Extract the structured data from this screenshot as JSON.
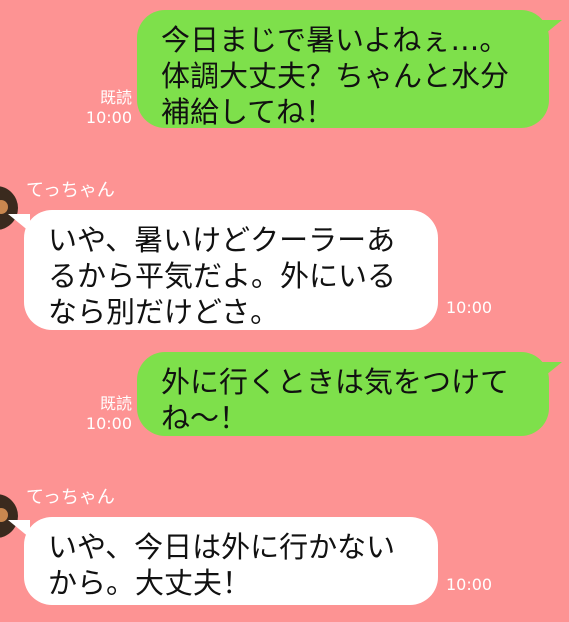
{
  "messages": [
    {
      "direction": "sent",
      "text": "今日まじで暑いよねぇ…。\n体調大丈夫？ちゃんと水分\n補給してね！",
      "read_label": "既読",
      "time": "10:00"
    },
    {
      "direction": "received",
      "sender": "てっちゃん",
      "text": "いや、暑いけどクーラーあ\nるから平気だよ。外にいる\nなら別だけどさ。",
      "time": "10:00"
    },
    {
      "direction": "sent",
      "text": "外に行くときは気をつけて\nね〜！",
      "read_label": "既読",
      "time": "10:00"
    },
    {
      "direction": "received",
      "sender": "てっちゃん",
      "text": "いや、今日は外に行かない\nから。大丈夫！",
      "time": "10:00"
    }
  ],
  "colors": {
    "background": "#fd9393",
    "sent_bubble": "#7ee04b",
    "received_bubble": "#ffffff",
    "meta_text": "#ffffff"
  }
}
